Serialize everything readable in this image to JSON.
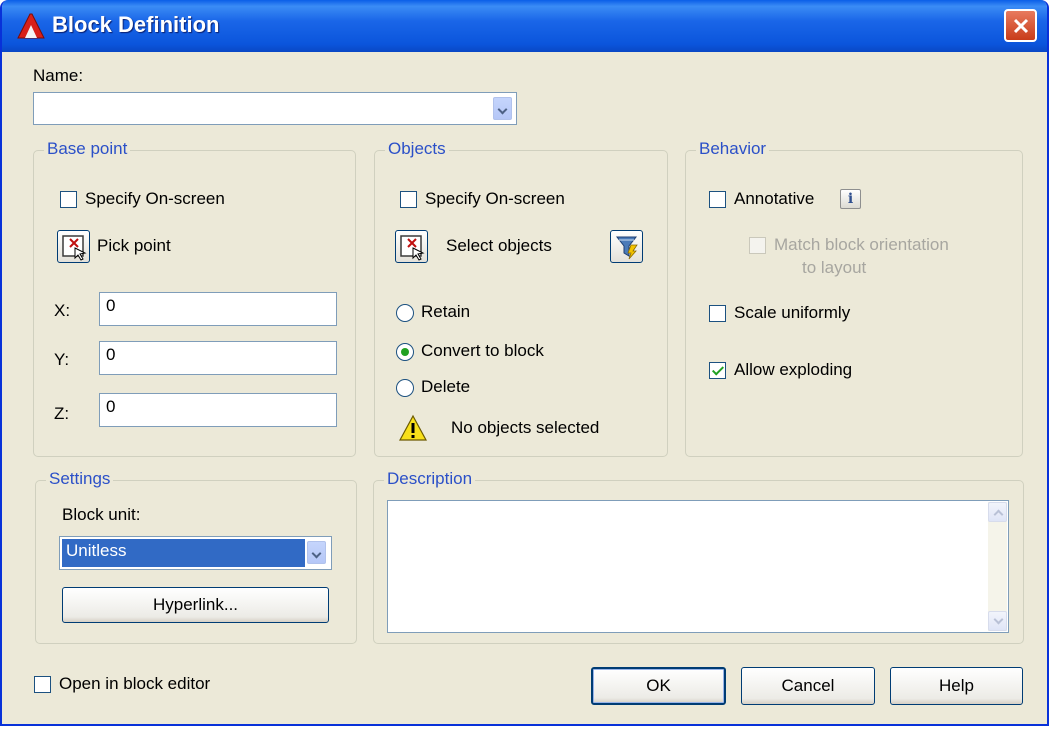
{
  "window": {
    "title": "Block Definition"
  },
  "name": {
    "label": "Name:",
    "value": ""
  },
  "base_point": {
    "title": "Base point",
    "specify_on_screen": {
      "label": "Specify On-screen",
      "checked": false
    },
    "pick_point_label": "Pick point",
    "x": {
      "label": "X:",
      "value": "0"
    },
    "y": {
      "label": "Y:",
      "value": "0"
    },
    "z": {
      "label": "Z:",
      "value": "0"
    }
  },
  "objects": {
    "title": "Objects",
    "specify_on_screen": {
      "label": "Specify On-screen",
      "checked": false
    },
    "select_objects_label": "Select objects",
    "retain_label": "Retain",
    "convert_label": "Convert to block",
    "delete_label": "Delete",
    "selected_option": "convert",
    "status_text": "No objects selected"
  },
  "behavior": {
    "title": "Behavior",
    "annotative": {
      "label": "Annotative",
      "checked": false
    },
    "match_orientation": {
      "label_line1": "Match block orientation",
      "label_line2": "to layout",
      "checked": false,
      "enabled": false
    },
    "scale_uniformly": {
      "label": "Scale uniformly",
      "checked": false
    },
    "allow_exploding": {
      "label": "Allow exploding",
      "checked": true
    }
  },
  "settings": {
    "title": "Settings",
    "block_unit_label": "Block unit:",
    "block_unit_value": "Unitless",
    "hyperlink_label": "Hyperlink..."
  },
  "description": {
    "title": "Description",
    "value": ""
  },
  "footer": {
    "open_in_editor": {
      "label": "Open in block editor",
      "checked": false
    },
    "ok_label": "OK",
    "cancel_label": "Cancel",
    "help_label": "Help"
  },
  "colors": {
    "dialog_bg": "#ece9d8",
    "titlebar": "#0a55dc",
    "group_title": "#2b50c8",
    "selection": "#316ac5"
  }
}
